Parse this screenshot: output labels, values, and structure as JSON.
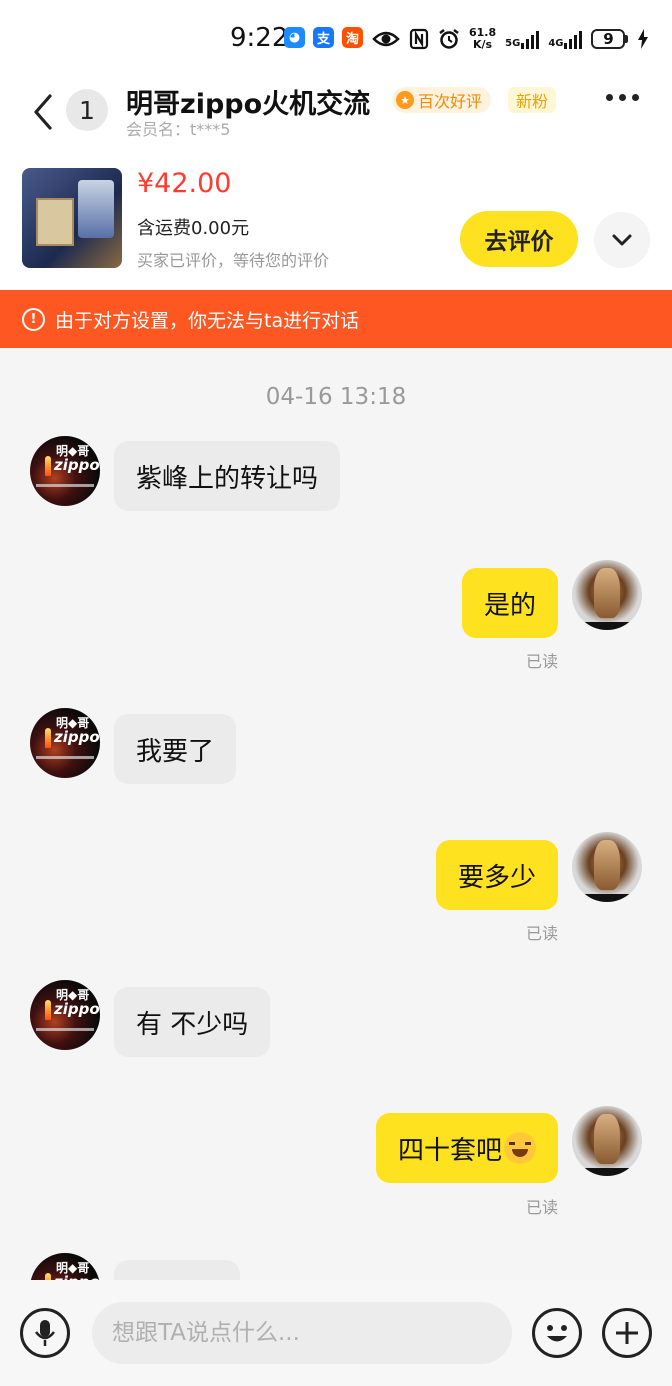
{
  "status_bar": {
    "time": "9:22",
    "apps": [
      {
        "icon": "qq-icon",
        "glyph": "◕",
        "color": "#1a8cff"
      },
      {
        "icon": "alipay-icon",
        "glyph": "支",
        "color": "#1677ff"
      },
      {
        "icon": "taobao-icon",
        "glyph": "淘",
        "color": "#ff5000"
      }
    ],
    "net_speed_value": "61.8",
    "net_speed_unit": "K/s",
    "signal_5g": "5G",
    "signal_4g": "4G",
    "battery": "9"
  },
  "header": {
    "unread_count": "1",
    "title": "明哥zippo火机交流",
    "tag_good": "百次好评",
    "tag_new": "新粉",
    "member_label": "会员名：t***5"
  },
  "product": {
    "price": "¥42.00",
    "shipping": "含运费0.00元",
    "status": "买家已评价，等待您的评价",
    "rate_button": "去评价"
  },
  "warning": {
    "text": "由于对方设置，你无法与ta进行对话"
  },
  "chat": {
    "timestamp": "04-16 13:18",
    "avatar_logo_top": "明◆哥",
    "avatar_logo": "zippo",
    "messages": [
      {
        "side": "left",
        "text": "紫峰上的转让吗"
      },
      {
        "side": "right",
        "text": "是的",
        "receipt": "已读"
      },
      {
        "side": "left",
        "text": "我要了"
      },
      {
        "side": "right",
        "text": "要多少",
        "receipt": "已读"
      },
      {
        "side": "left",
        "text": "有 不少吗"
      },
      {
        "side": "right",
        "text": "四十套吧",
        "receipt": "已读"
      }
    ]
  },
  "input": {
    "placeholder": "想跟TA说点什么..."
  },
  "colors": {
    "accent_yellow": "#ffe21f",
    "price_red": "#ff3b30",
    "warning_orange": "#ff5722"
  }
}
